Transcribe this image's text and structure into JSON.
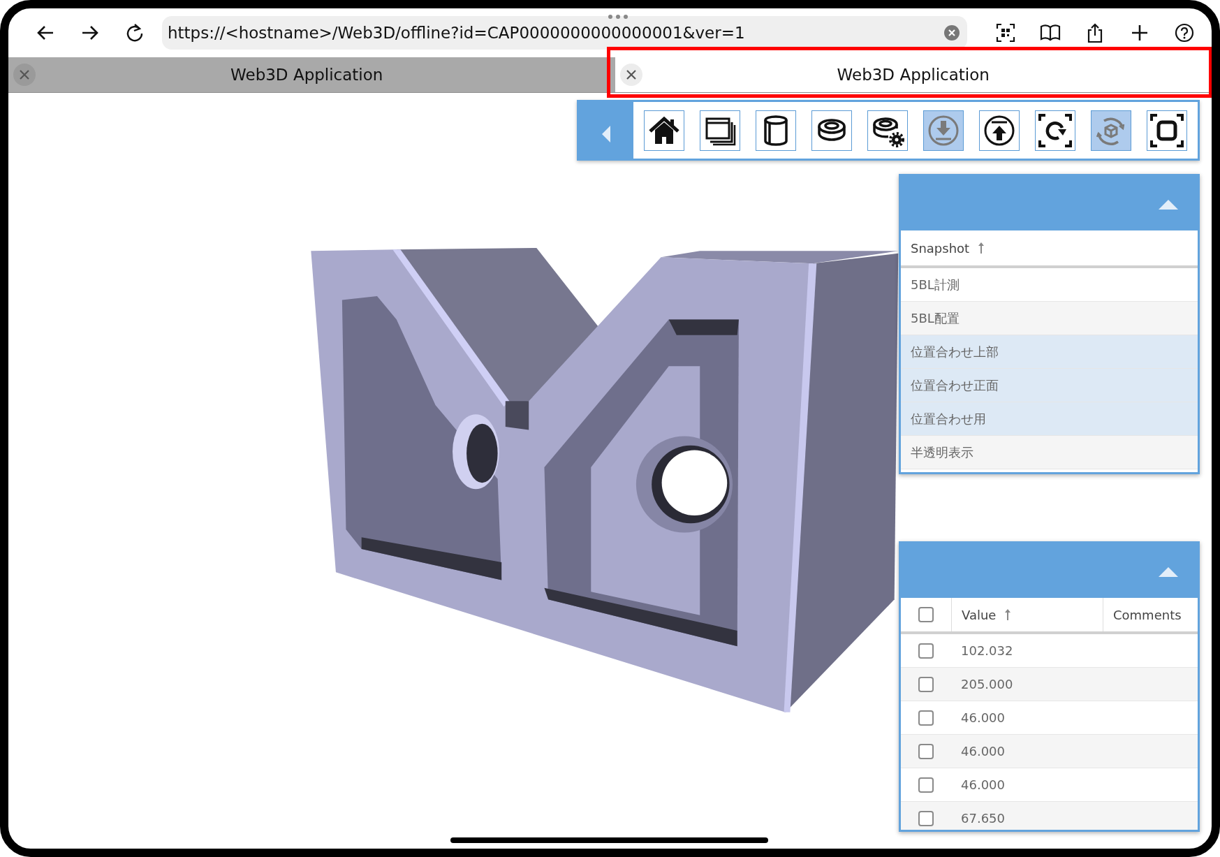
{
  "browser": {
    "url": "https://<hostname>/Web3D/offline?id=CAP0000000000000001&ver=1"
  },
  "tabs": [
    {
      "title": "Web3D Application",
      "selected": false,
      "highlighted": false
    },
    {
      "title": "Web3D Application",
      "selected": true,
      "highlighted": true
    }
  ],
  "toolbar": {
    "buttons": [
      {
        "active": false
      },
      {
        "active": false
      },
      {
        "active": false
      },
      {
        "active": false
      },
      {
        "active": false
      },
      {
        "active": true
      },
      {
        "active": false
      },
      {
        "active": false
      },
      {
        "active": true
      },
      {
        "active": false
      }
    ]
  },
  "snapshot_panel": {
    "expanded": true,
    "column": "Snapshot",
    "sort_ascending": true,
    "rows": [
      {
        "name": "5BL計測",
        "selected": false
      },
      {
        "name": "5BL配置",
        "selected": false
      },
      {
        "name": "位置合わせ上部",
        "selected": true
      },
      {
        "name": "位置合わせ正面",
        "selected": true
      },
      {
        "name": "位置合わせ用",
        "selected": true
      },
      {
        "name": "半透明表示",
        "selected": false
      }
    ]
  },
  "value_panel": {
    "expanded": true,
    "header_checked": false,
    "columns": [
      "Value",
      "Comments"
    ],
    "sort_ascending": true,
    "rows": [
      {
        "value": "102.032",
        "checked": false
      },
      {
        "value": "205.000",
        "checked": false
      },
      {
        "value": "46.000",
        "checked": false
      },
      {
        "value": "46.000",
        "checked": false
      },
      {
        "value": "46.000",
        "checked": false
      },
      {
        "value": "67.650",
        "checked": false
      }
    ]
  }
}
